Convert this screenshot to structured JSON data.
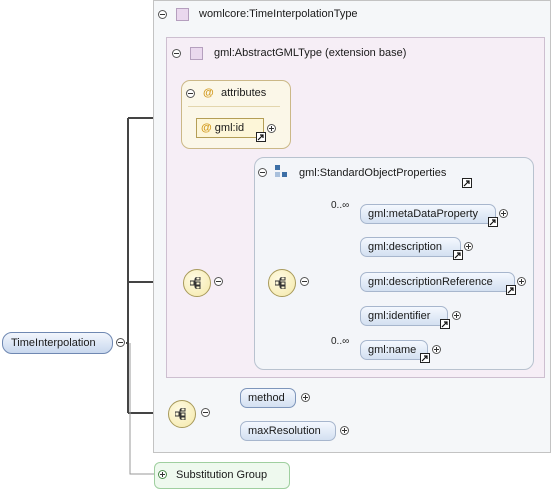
{
  "root_element": {
    "label": "TimeInterpolation"
  },
  "complex_type": {
    "label": "womlcore:TimeInterpolationType"
  },
  "extension": {
    "label": "gml:AbstractGMLType (extension base)"
  },
  "attributes_group": {
    "label": "attributes",
    "items": [
      {
        "label": "gml:id"
      }
    ]
  },
  "standard_object_properties": {
    "label": "gml:StandardObjectProperties",
    "elements": [
      {
        "label": "gml:metaDataProperty",
        "occurrence": "0..∞"
      },
      {
        "label": "gml:description",
        "occurrence": ""
      },
      {
        "label": "gml:descriptionReference",
        "occurrence": ""
      },
      {
        "label": "gml:identifier",
        "occurrence": ""
      },
      {
        "label": "gml:name",
        "occurrence": "0..∞"
      }
    ]
  },
  "local_elements": [
    {
      "label": "method"
    },
    {
      "label": "maxResolution"
    }
  ],
  "substitution_group": {
    "label": "Substitution Group"
  },
  "colors": {
    "connector": "#444444",
    "element_fill": "#d3e0f1",
    "extension_fill": "#f6eef6",
    "attribute_fill": "#fbf7e8",
    "substitution_fill": "#eef9ee"
  },
  "icons": {
    "collapse": "minus-circle-icon",
    "expand": "plus-circle-icon",
    "reference": "reference-arrow-icon",
    "sequence": "sequence-compositor-icon",
    "attribute": "at-sign-icon",
    "group": "group-squares-icon"
  }
}
